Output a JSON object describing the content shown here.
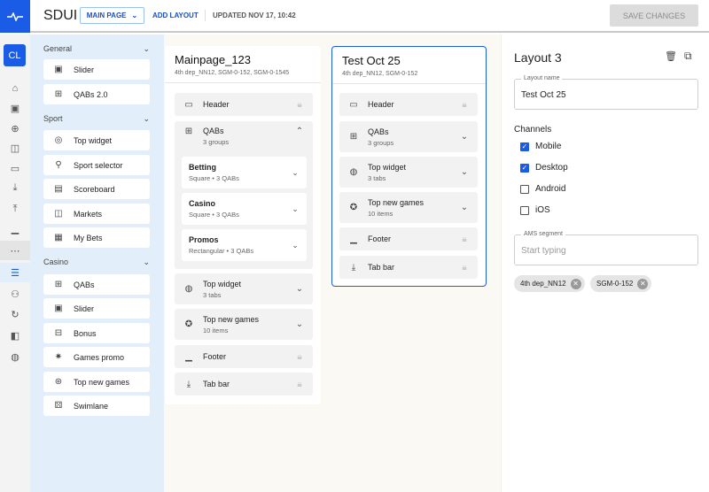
{
  "header": {
    "app_title": "SDUI",
    "page_select": "MAIN PAGE",
    "add_layout": "ADD LAYOUT",
    "updated": "UPDATED NOV 17, 10:42",
    "save": "SAVE CHANGES"
  },
  "rail": {
    "avatar": "CL",
    "icons": [
      "home-icon",
      "image-icon",
      "add-circle-icon",
      "dashboard-icon",
      "window-icon",
      "download-icon",
      "upload-icon",
      "footer-icon",
      "more-icon",
      "list-icon",
      "people-icon",
      "refresh-icon",
      "compare-icon",
      "badge-icon"
    ]
  },
  "palette": {
    "sections": [
      {
        "title": "General",
        "items": [
          "Slider",
          "QABs 2.0"
        ]
      },
      {
        "title": "Sport",
        "items": [
          "Top widget",
          "Sport selector",
          "Scoreboard",
          "Markets",
          "My Bets"
        ]
      },
      {
        "title": "Casino",
        "items": [
          "QABs",
          "Slider",
          "Bonus",
          "Games promo",
          "Top new games",
          "Swimlane"
        ]
      }
    ]
  },
  "layouts": [
    {
      "title": "Mainpage_123",
      "segments": "4th dep_NN12, SGM-0-152, SGM-0-1545",
      "components": [
        {
          "name": "Header"
        },
        {
          "name": "QABs",
          "meta": "3 groups"
        },
        {
          "name": "Top widget",
          "meta": "3 tabs"
        },
        {
          "name": "Top new games",
          "meta": "10 items"
        },
        {
          "name": "Footer"
        },
        {
          "name": "Tab bar"
        }
      ],
      "qab_groups": [
        {
          "name": "Betting",
          "meta": "Square • 3 QABs"
        },
        {
          "name": "Casino",
          "meta": "Square • 3 QABs"
        },
        {
          "name": "Promos",
          "meta": "Rectangular • 3 QABs"
        }
      ]
    },
    {
      "title": "Test Oct 25",
      "segments": "4th dep_NN12, SGM-0-152",
      "components": [
        {
          "name": "Header"
        },
        {
          "name": "QABs",
          "meta": "3 groups"
        },
        {
          "name": "Top widget",
          "meta": "3 tabs"
        },
        {
          "name": "Top new games",
          "meta": "10 items"
        },
        {
          "name": "Footer"
        },
        {
          "name": "Tab bar"
        }
      ]
    }
  ],
  "panel": {
    "title": "Layout 3",
    "name_label": "Layout name",
    "name_value": "Test Oct 25",
    "channels_label": "Channels",
    "channels": [
      {
        "label": "Mobile",
        "checked": true
      },
      {
        "label": "Desktop",
        "checked": true
      },
      {
        "label": "Android",
        "checked": false
      },
      {
        "label": "iOS",
        "checked": false
      }
    ],
    "segment_label": "AMS segment",
    "segment_placeholder": "Start typing",
    "chips": [
      "4th dep_NN12",
      "SGM-0-152"
    ]
  },
  "colors": {
    "accent": "#1a5ce6",
    "palette_bg": "#e2effb"
  }
}
